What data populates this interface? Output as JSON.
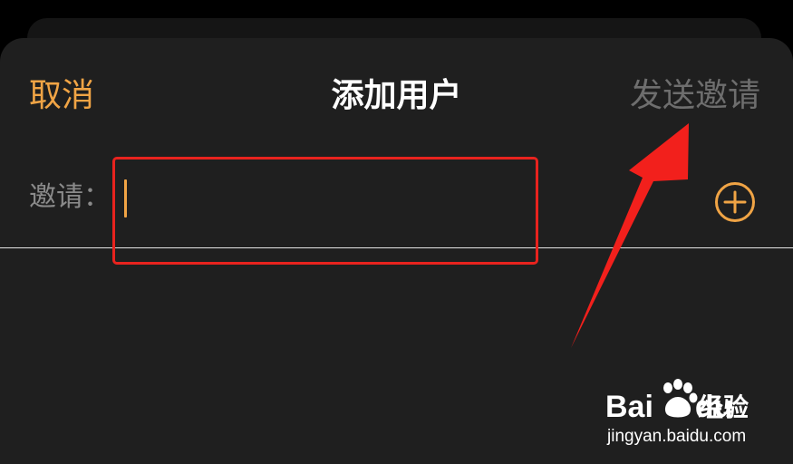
{
  "nav": {
    "cancel_label": "取消",
    "title": "添加用户",
    "send_label": "发送邀请"
  },
  "invite": {
    "label": "邀请：",
    "value": "",
    "placeholder": ""
  },
  "icons": {
    "add": "plus-circle-icon"
  },
  "watermark": {
    "brand_left": "Bai",
    "brand_right": "du",
    "product": "经验",
    "url": "jingyan.baidu.com"
  },
  "colors": {
    "accent": "#f0a445",
    "annotation": "#e8231e",
    "sheet_bg": "#1f1f1f",
    "disabled_text": "#6e6e6e"
  }
}
